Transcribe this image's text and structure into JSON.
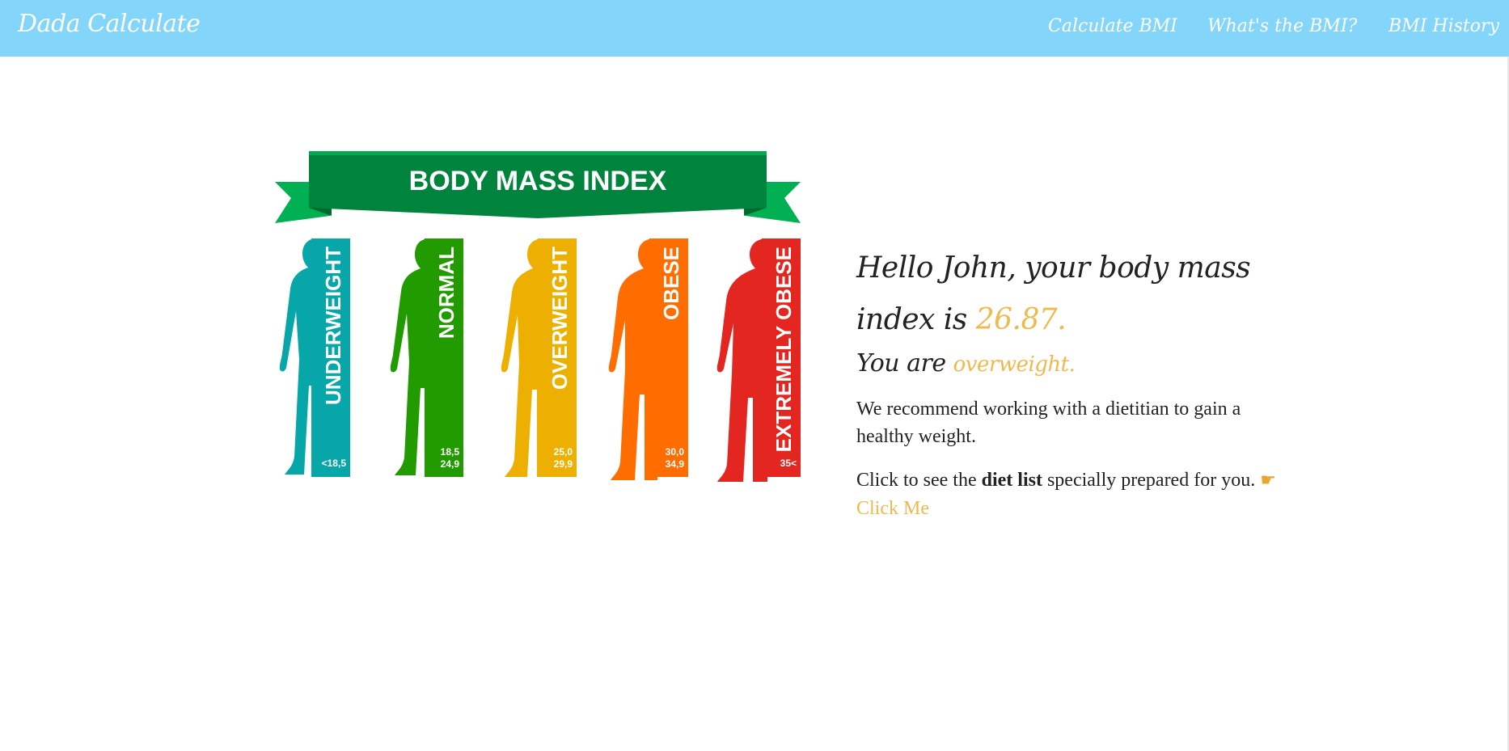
{
  "navbar": {
    "brand": "Dada Calculate",
    "links": [
      {
        "label": "Calculate BMI"
      },
      {
        "label": "What's the BMI?"
      },
      {
        "label": "BMI History"
      }
    ]
  },
  "figure": {
    "banner_title": "BODY MASS INDEX",
    "categories": [
      {
        "label": "UNDERWEIGHT",
        "range_line1": "<18,5",
        "range_line2": "",
        "color": "#06a6a9"
      },
      {
        "label": "NORMAL",
        "range_line1": "18,5",
        "range_line2": "24,9",
        "color": "#229b00"
      },
      {
        "label": "OVERWEIGHT",
        "range_line1": "25,0",
        "range_line2": "29,9",
        "color": "#edb000"
      },
      {
        "label": "OBESE",
        "range_line1": "30,0",
        "range_line2": "34,9",
        "color": "#ff6c00"
      },
      {
        "label": "EXTREMELY OBESE",
        "range_line1": "35<",
        "range_line2": "",
        "color": "#e3261f"
      }
    ],
    "banner_color": "#00843d",
    "banner_wing_color": "#00b052"
  },
  "result": {
    "greeting_prefix": "Hello John, your body mass index is ",
    "bmi_value": "26.87.",
    "status_prefix": "You are ",
    "status_value": "overweight.",
    "recommendation": "We recommend working with a dietitian to gain a healthy weight.",
    "diet_prefix": "Click to see the ",
    "diet_bold": "diet list",
    "diet_suffix": " specially prepared for you. ",
    "hand_icon": "☛",
    "click_label": "Click Me"
  },
  "colors": {
    "navbar": "#83d5f9",
    "accent": "#f0b94d"
  }
}
